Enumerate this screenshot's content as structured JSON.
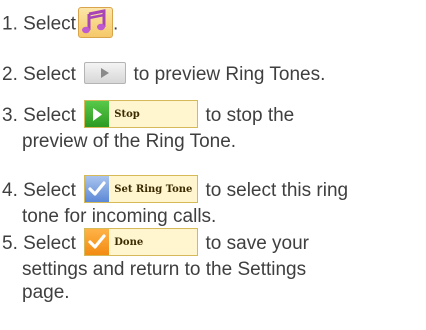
{
  "steps": [
    {
      "number": "1.",
      "before": "Select",
      "after": "."
    },
    {
      "number": "2.",
      "before": "Select",
      "after": "to preview Ring Tones."
    },
    {
      "number": "3.",
      "before": "Select",
      "button_label": "Stop",
      "after": "to stop the",
      "continuation": "preview of the Ring Tone."
    },
    {
      "number": "4.",
      "before": "Select",
      "button_label": "Set Ring Tone",
      "after": "to select this ring",
      "continuation": "tone for incoming calls."
    },
    {
      "number": "5.",
      "before": "Select",
      "button_label": "Done",
      "after": "to save your",
      "continuation": "settings and return to the Settings",
      "continuation2": "page."
    }
  ],
  "icons": {
    "step1": "music-notes-icon",
    "step2": "play-icon",
    "step3": "play-icon",
    "step4": "checkmark-icon",
    "step5": "checkmark-icon"
  },
  "colors": {
    "text": "#3f3f3f",
    "button_fill": "#fff6cf",
    "button_border": "#d6b958",
    "play_green": "#2c9a22",
    "check_blue": "#5b88d6",
    "check_orange": "#f28b12",
    "music_icon": "#f5c868"
  }
}
